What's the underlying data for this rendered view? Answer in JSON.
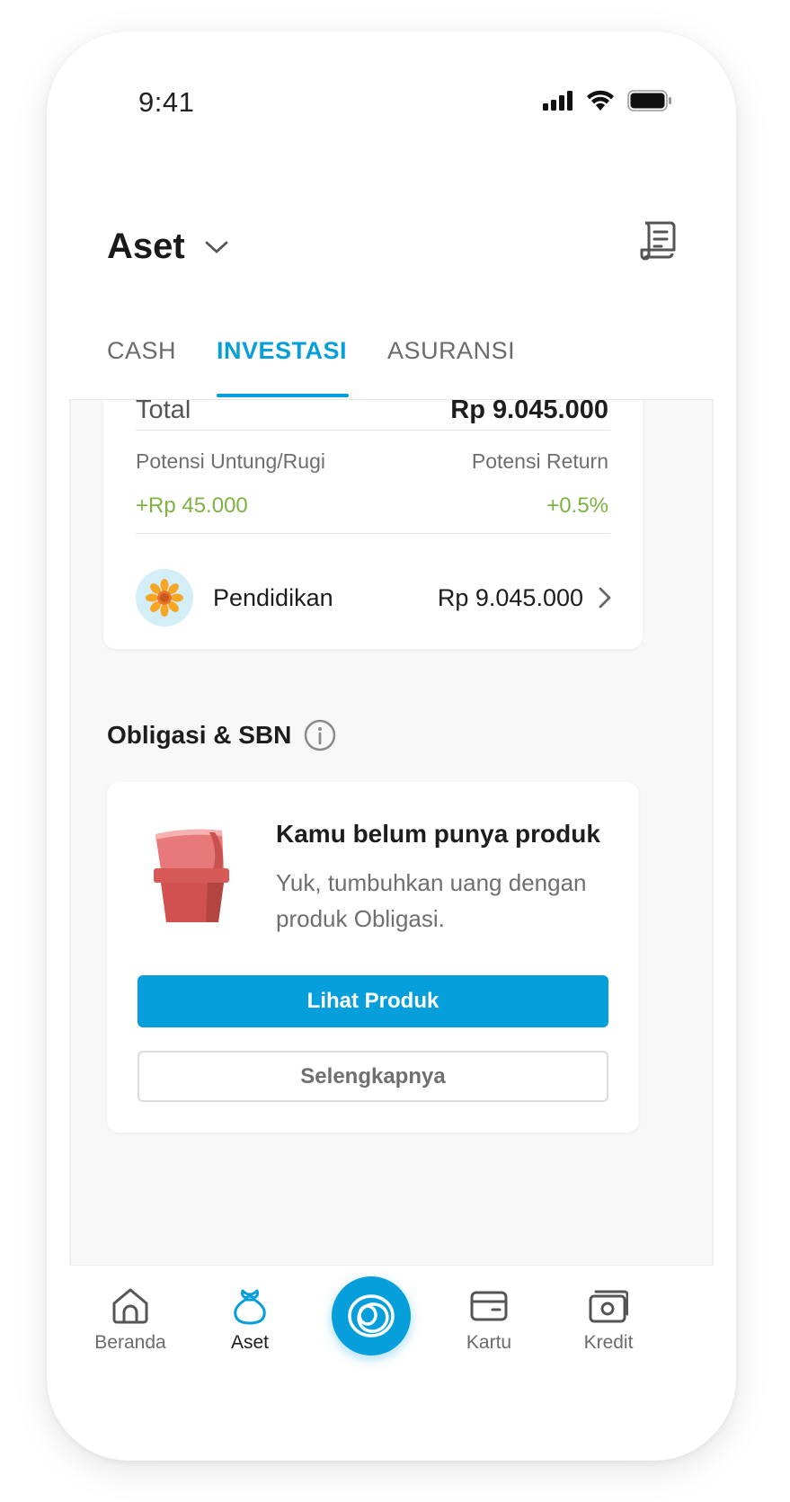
{
  "status_bar": {
    "time": "9:41"
  },
  "header": {
    "title": "Aset"
  },
  "tabs": [
    {
      "label": "CASH",
      "active": false
    },
    {
      "label": "INVESTASI",
      "active": true
    },
    {
      "label": "ASURANSI",
      "active": false
    }
  ],
  "summary": {
    "total_label": "Total",
    "total_value": "Rp 9.045.000",
    "potensi_untung_label": "Potensi Untung/Rugi",
    "potensi_untung_value": "+Rp 45.000",
    "potensi_return_label": "Potensi Return",
    "potensi_return_value": "+0.5%",
    "goal": {
      "name": "Pendidikan",
      "value": "Rp 9.045.000",
      "icon": "sunflower-icon"
    }
  },
  "obligasi": {
    "title": "Obligasi & SBN",
    "empty_title": "Kamu belum punya produk",
    "empty_desc": "Yuk, tumbuhkan uang dengan produk Obligasi.",
    "primary_button": "Lihat Produk",
    "secondary_button": "Selengkapnya"
  },
  "bottom_nav": [
    {
      "label": "Beranda",
      "icon": "home-icon",
      "active": false
    },
    {
      "label": "Aset",
      "icon": "money-bag-icon",
      "active": true
    },
    {
      "label": "Kartu",
      "icon": "card-icon",
      "active": false
    },
    {
      "label": "Kredit",
      "icon": "cash-icon",
      "active": false
    }
  ],
  "colors": {
    "accent": "#069edb",
    "positive": "#7cb342",
    "background": "#f8f8f8"
  }
}
